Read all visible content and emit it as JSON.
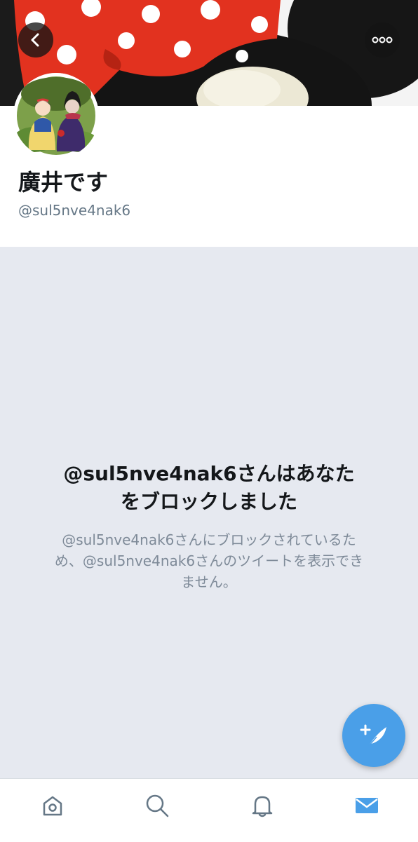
{
  "profile": {
    "display_name": "廣井です",
    "handle": "@sul5nve4nak6"
  },
  "blocked": {
    "title_line1": "@sul5nve4nak6さんはあなた",
    "title_line2": "をブロックしました",
    "desc_line1": "@sul5nve4nak6さんにブロックされているた",
    "desc_line2": "め、@sul5nve4nak6さんのツイートを表示でき",
    "desc_line3": "ません。"
  },
  "icons": {
    "back": "chevron-left-icon",
    "more": "more-dots-icon",
    "compose": "compose-tweet-icon",
    "tabs": [
      "home-icon",
      "search-icon",
      "bell-icon",
      "mail-icon"
    ]
  },
  "colors": {
    "accent": "#4a9fe8",
    "background": "#e6e9f0",
    "primary_text": "#14171a",
    "secondary_text": "#657786",
    "banner_red": "#e2321f"
  }
}
